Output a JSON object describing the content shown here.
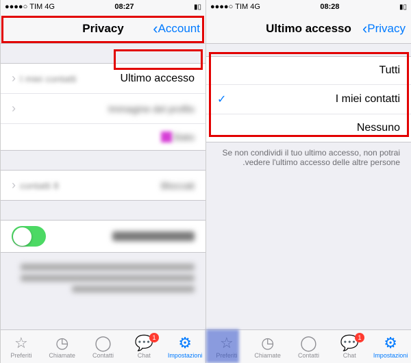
{
  "left_panel": {
    "status": {
      "carrier": "TIM 4G",
      "time": "08:27",
      "signal": "●●●●○"
    },
    "nav": {
      "back_label": "Account",
      "title": "Privacy"
    },
    "rows": {
      "ultimo_accesso": "Ultimo accesso",
      "r1": "Immagine del profilo",
      "r2": "Stato",
      "r3": "Bloccati",
      "r4_val": "8 contatti",
      "r5": "Conferme di lettura"
    },
    "right_value": "I miei contatti"
  },
  "right_panel": {
    "status": {
      "carrier": "TIM 4G",
      "time": "08:28",
      "signal": "●●●●○"
    },
    "nav": {
      "back_label": "Privacy",
      "title": "Ultimo accesso"
    },
    "options": {
      "tutti": "Tutti",
      "contatti": "I miei contatti",
      "nessuno": "Nessuno"
    },
    "footer": "Se non condividi il tuo ultimo accesso, non potrai vedere l'ultimo accesso delle altre persone."
  },
  "tabs": {
    "preferiti": "Preferiti",
    "chiamate": "Chiamate",
    "contatti": "Contatti",
    "chat": "Chat",
    "impostazioni": "Impostazioni"
  }
}
